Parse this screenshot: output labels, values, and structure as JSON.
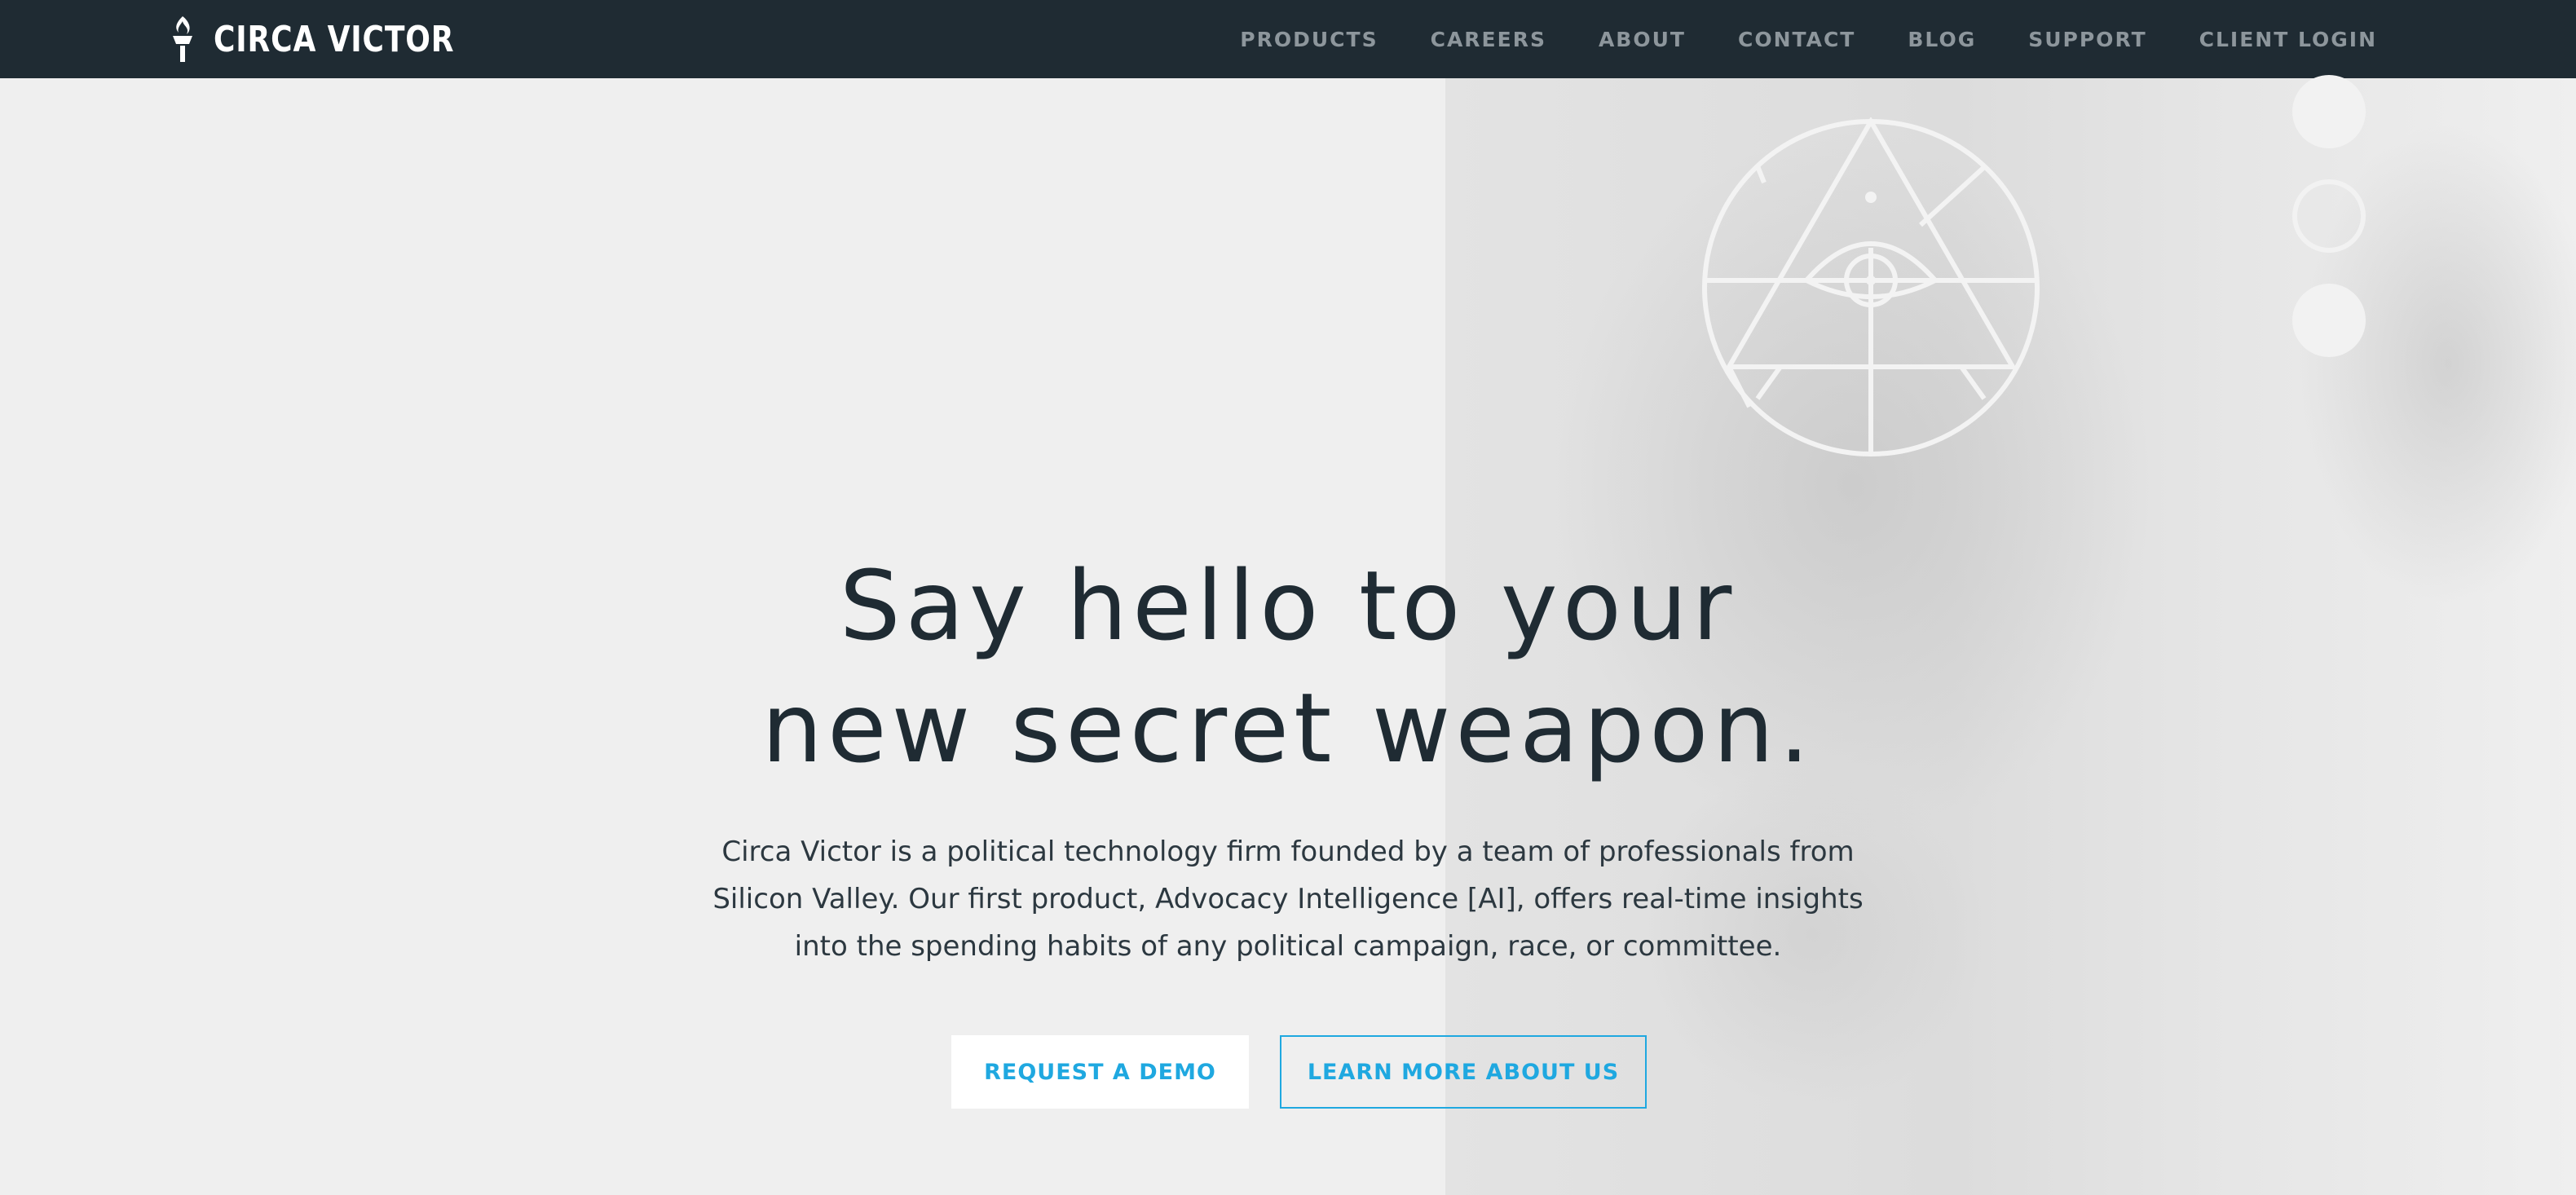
{
  "header": {
    "brand_name": "CIRCA VICTOR",
    "logo_icon": "torch-icon",
    "nav": [
      {
        "label": "PRODUCTS"
      },
      {
        "label": "CAREERS"
      },
      {
        "label": "ABOUT"
      },
      {
        "label": "CONTACT"
      },
      {
        "label": "BLOG"
      },
      {
        "label": "SUPPORT"
      },
      {
        "label": "CLIENT LOGIN"
      }
    ]
  },
  "hero": {
    "title_line1": "Say hello to your",
    "title_line2": "new secret weapon.",
    "description": "Circa Victor is a political technology firm founded by a team of professionals from Silicon Valley. Our first product, Advocacy Intelligence [AI], offers real-time insights into the spending habits of any political campaign, race, or committee.",
    "primary_button": "REQUEST A DEMO",
    "secondary_button": "LEARN MORE ABOUT US",
    "emblem_icon": "all-seeing-eye-icon"
  },
  "slider": {
    "dots": 3,
    "active_index": 1
  },
  "colors": {
    "header_bg": "#1f2b33",
    "accent": "#1fa8e0",
    "page_bg": "#efefef",
    "heading": "#1f2b33"
  }
}
